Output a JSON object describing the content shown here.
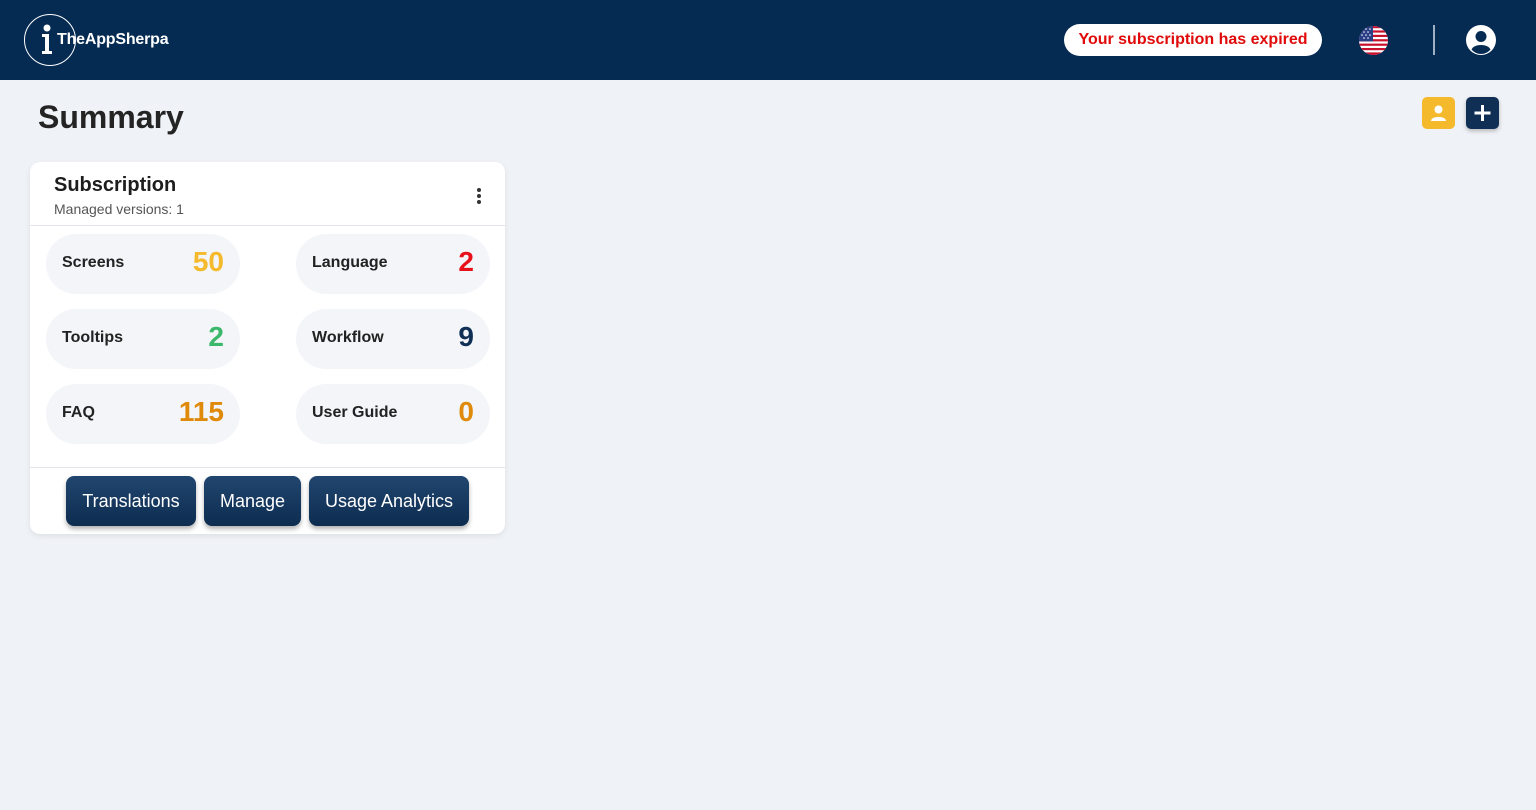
{
  "header": {
    "logo_text": "TheAppSherpa",
    "subscription_alert": "Your subscription has expired"
  },
  "page": {
    "title": "Summary"
  },
  "card": {
    "title": "Subscription",
    "subtitle": "Managed versions: 1",
    "stats": [
      {
        "label": "Screens",
        "value": "50",
        "color": "#f5b92c"
      },
      {
        "label": "Language",
        "value": "2",
        "color": "#e8101a"
      },
      {
        "label": "Tooltips",
        "value": "2",
        "color": "#3bb86a"
      },
      {
        "label": "Workflow",
        "value": "9",
        "color": "#0f2f55"
      },
      {
        "label": "FAQ",
        "value": "115",
        "color": "#e08a0c"
      },
      {
        "label": "User Guide",
        "value": "0",
        "color": "#e08a0c"
      }
    ],
    "actions": [
      {
        "label": "Translations"
      },
      {
        "label": "Manage"
      },
      {
        "label": "Usage Analytics"
      }
    ]
  },
  "icons": {
    "contact": "person-icon",
    "add": "plus-icon",
    "flag": "us-flag-icon",
    "user": "user-circle-icon",
    "more": "vertical-ellipsis-icon"
  }
}
